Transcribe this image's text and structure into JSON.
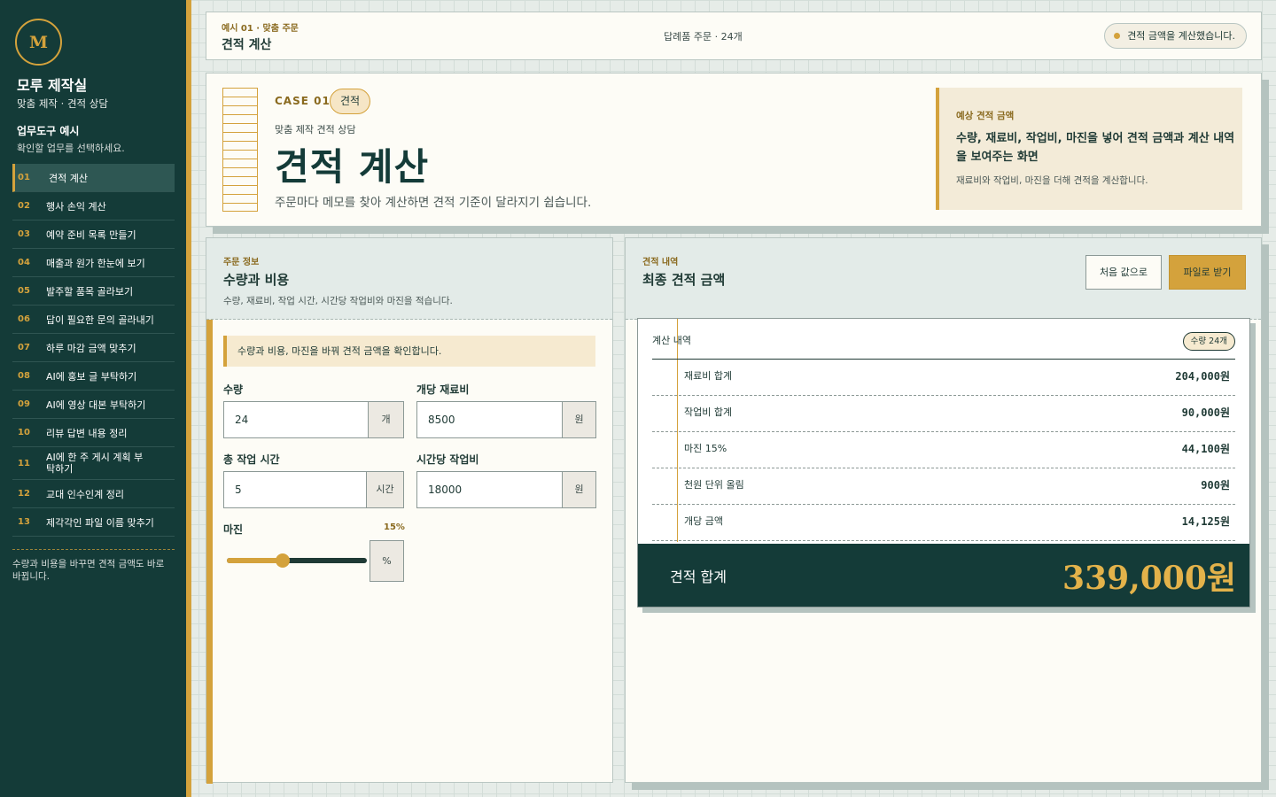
{
  "sidebar": {
    "logo": "M",
    "brand": "모루 제작실",
    "brand_sub": "맞춤 제작 · 견적 상담",
    "section_title": "업무도구 예시",
    "section_sub": "확인할 업무를 선택하세요.",
    "items": [
      {
        "num": "01",
        "label": "견적 계산"
      },
      {
        "num": "02",
        "label": "행사 손익 계산"
      },
      {
        "num": "03",
        "label": "예약 준비 목록 만들기"
      },
      {
        "num": "04",
        "label": "매출과 원가 한눈에 보기"
      },
      {
        "num": "05",
        "label": "발주할 품목 골라보기"
      },
      {
        "num": "06",
        "label": "답이 필요한 문의 골라내기"
      },
      {
        "num": "07",
        "label": "하루 마감 금액 맞추기"
      },
      {
        "num": "08",
        "label": "AI에 홍보 글 부탁하기"
      },
      {
        "num": "09",
        "label": "AI에 영상 대본 부탁하기"
      },
      {
        "num": "10",
        "label": "리뷰 답변 내용 정리"
      },
      {
        "num": "11",
        "label": "AI에 한 주 게시 계획 부탁하기"
      },
      {
        "num": "12",
        "label": "교대 인수인계 정리"
      },
      {
        "num": "13",
        "label": "제각각인 파일 이름 맞추기"
      }
    ],
    "footer": "수량과 비용을 바꾸면 견적 금액도 바로 바뀝니다."
  },
  "topbar": {
    "eyebrow": "예시 01 · 맞춤 주문",
    "title": "견적 계산",
    "center": "답례품 주문 · 24개",
    "status": "견적 금액을 계산했습니다."
  },
  "hero": {
    "case_tag": "CASE 01",
    "case_pill": "견적",
    "sub": "맞춤 제작 견적 상담",
    "title": "견적 계산",
    "desc": "주문마다 메모를 찾아 계산하면 견적 기준이 달라지기 쉽습니다.",
    "est_label": "예상 견적 금액",
    "est_text": "수량, 재료비, 작업비, 마진을 넣어 견적 금액과 계산 내역을 보여주는 화면",
    "est_note": "재료비와 작업비, 마진을 더해 견적을 계산합니다."
  },
  "order": {
    "eyebrow": "주문 정보",
    "title": "수량과 비용",
    "sub": "수량, 재료비, 작업 시간, 시간당 작업비와 마진을 적습니다.",
    "info": "수량과 비용, 마진을 바꿔 견적 금액을 확인합니다.",
    "qty_label": "수량",
    "qty_value": "24",
    "qty_unit": "개",
    "material_label": "개당 재료비",
    "material_value": "8500",
    "material_unit": "원",
    "hours_label": "총 작업 시간",
    "hours_value": "5",
    "hours_unit": "시간",
    "rate_label": "시간당 작업비",
    "rate_value": "18000",
    "rate_unit": "원",
    "margin_label": "마진",
    "margin_value": "15%",
    "margin_unit": "%",
    "margin_fraction": 0.4
  },
  "estimate": {
    "eyebrow": "견적 내역",
    "title": "최종 견적 금액",
    "reset_label": "처음 값으로",
    "file_label": "파일로 받기",
    "calc_header": "계산 내역",
    "qty_pill": "수량 24개",
    "rows": [
      {
        "label": "재료비 합계",
        "amount": "204,000원"
      },
      {
        "label": "작업비 합계",
        "amount": "90,000원"
      },
      {
        "label": "마진 15%",
        "amount": "44,100원"
      },
      {
        "label": "천원 단위 올림",
        "amount": "900원"
      },
      {
        "label": "개당 금액",
        "amount": "14,125원"
      }
    ],
    "total_label": "견적 합계",
    "total_amount": "339,000원"
  },
  "colors": {
    "sidebar": "#143b38",
    "accent": "#d4a23c",
    "paper": "#fdfcf6"
  }
}
